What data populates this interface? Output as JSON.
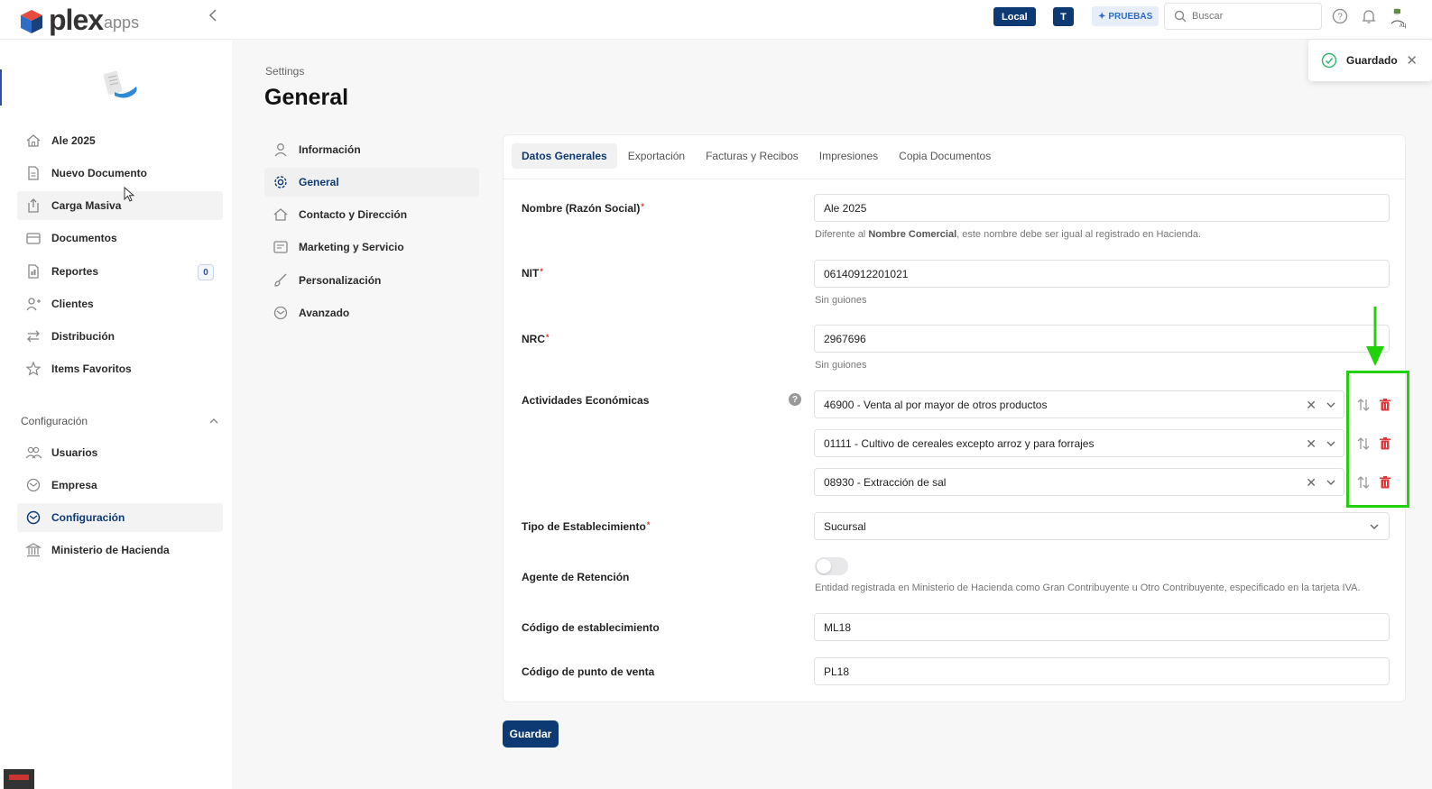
{
  "app": {
    "logo_text": "plex",
    "logo_sub": "apps"
  },
  "topbar": {
    "env_local": "Local",
    "env_user": "T",
    "env_pruebas": "PRUEBAS",
    "search_placeholder": "Buscar"
  },
  "toast": {
    "message": "Guardado"
  },
  "sidebar": {
    "items": [
      {
        "label": "Ale 2025",
        "icon": "home-icon"
      },
      {
        "label": "Nuevo Documento",
        "icon": "document-icon"
      },
      {
        "label": "Carga Masiva",
        "icon": "upload-icon"
      },
      {
        "label": "Documentos",
        "icon": "archive-icon"
      },
      {
        "label": "Reportes",
        "icon": "report-icon",
        "count": "0"
      },
      {
        "label": "Clientes",
        "icon": "users-icon"
      },
      {
        "label": "Distribución",
        "icon": "transfer-icon"
      },
      {
        "label": "Items Favoritos",
        "icon": "star-icon"
      }
    ],
    "section_title": "Configuración",
    "config_items": [
      {
        "label": "Usuarios",
        "icon": "users-icon"
      },
      {
        "label": "Empresa",
        "icon": "settings-icon"
      },
      {
        "label": "Configuración",
        "icon": "settings-icon"
      },
      {
        "label": "Ministerio de Hacienda",
        "icon": "bank-icon"
      }
    ]
  },
  "header": {
    "breadcrumb": "Settings",
    "title": "General"
  },
  "settings_menu": [
    {
      "label": "Información",
      "icon": "user-icon"
    },
    {
      "label": "General",
      "icon": "gear-icon"
    },
    {
      "label": "Contacto y Dirección",
      "icon": "home-icon"
    },
    {
      "label": "Marketing y Servicio",
      "icon": "image-icon"
    },
    {
      "label": "Personalización",
      "icon": "brush-icon"
    },
    {
      "label": "Avanzado",
      "icon": "settings-icon"
    }
  ],
  "tabs": [
    "Datos Generales",
    "Exportación",
    "Facturas y Recibos",
    "Impresiones",
    "Copia Documentos"
  ],
  "form": {
    "nombre": {
      "label": "Nombre (Razón Social)",
      "value": "Ale 2025",
      "help_pre": "Diferente al ",
      "help_bold": "Nombre Comercial",
      "help_post": ", este nombre debe ser igual al registrado en Hacienda."
    },
    "nit": {
      "label": "NIT",
      "value": "06140912201021",
      "help": "Sin guiones"
    },
    "nrc": {
      "label": "NRC",
      "value": "2967696",
      "help": "Sin guiones"
    },
    "actividades": {
      "label": "Actividades Económicas",
      "help_glyph": "?",
      "items": [
        "46900 - Venta al por mayor de otros productos",
        "01111 - Cultivo de cereales excepto arroz y para forrajes",
        "08930 - Extracción de sal"
      ]
    },
    "tipo": {
      "label": "Tipo de Establecimiento",
      "value": "Sucursal"
    },
    "agente": {
      "label": "Agente de Retención",
      "enabled": false,
      "help": "Entidad registrada en Ministerio de Hacienda como Gran Contribuyente u Otro Contribuyente, especificado en la tarjeta IVA."
    },
    "codigo_est": {
      "label": "Código de establecimiento",
      "value": "ML18"
    },
    "codigo_pv": {
      "label": "Código de punto de venta",
      "value": "PL18"
    }
  },
  "actions": {
    "save_label": "Guardar"
  },
  "colors": {
    "primary": "#0d3a73",
    "annotation": "#22d10c",
    "danger": "#e0383b"
  }
}
